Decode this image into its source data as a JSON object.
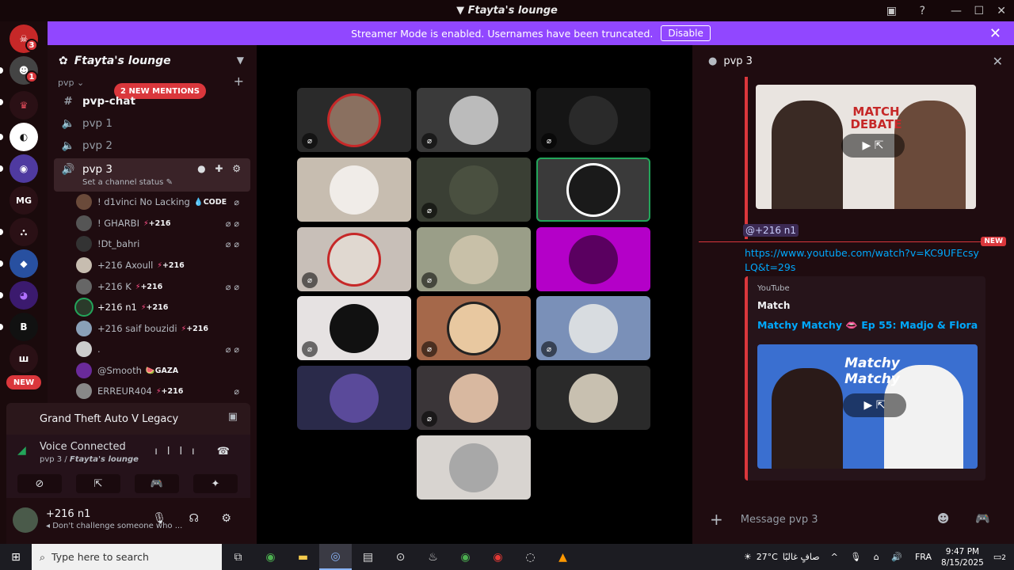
{
  "window": {
    "title": "Ftayta's lounge"
  },
  "servers": {
    "badges": [
      "3",
      "1"
    ],
    "new_label": "NEW",
    "mg_label": "MG"
  },
  "banner": {
    "text": "Streamer Mode is enabled. Usernames have been truncated.",
    "button": "Disable"
  },
  "sidebar": {
    "guild_name": "Ftayta's lounge",
    "category": "pvp",
    "mentions": "2 NEW MENTIONS",
    "channels": [
      {
        "label": "pvp-chat",
        "type": "text"
      },
      {
        "label": "pvp 1",
        "type": "voice"
      },
      {
        "label": "pvp 2",
        "type": "voice"
      },
      {
        "label": "pvp 3",
        "type": "voice",
        "status": "Set a channel status"
      }
    ],
    "voice_users": [
      {
        "name": "! d1vinci No Lacking",
        "tag": "CODE"
      },
      {
        "name": "! GHARBI",
        "tag": "+216"
      },
      {
        "name": "!Dt_bahri",
        "tag": ""
      },
      {
        "name": "+216 Axoull",
        "tag": "+216"
      },
      {
        "name": "+216 K",
        "tag": "+216"
      },
      {
        "name": "+216 n1",
        "tag": "+216"
      },
      {
        "name": "+216 saif bouzidi",
        "tag": "+216"
      },
      {
        "name": ".",
        "tag": ""
      },
      {
        "name": "@Smooth",
        "tag": "GAZA"
      },
      {
        "name": "ERREUR404",
        "tag": "+216"
      }
    ]
  },
  "activity": {
    "game": "Grand Theft Auto V Legacy"
  },
  "voice": {
    "status": "Voice Connected",
    "channel": "pvp 3",
    "server": "Ftayta's lounge"
  },
  "me": {
    "name": "+216 n1",
    "status": "Don't challenge someone who ..."
  },
  "chat": {
    "channel": "pvp 3",
    "mention": "@+216 n1",
    "new_tag": "NEW",
    "link": "https://www.youtube.com/watch?v=KC9UFEcsyLQ&t=29s",
    "embed_provider": "YouTube",
    "embed_author": "Match",
    "embed_title": "Matchy Matchy 👄 Ep 55: Madjo & Flora",
    "thumb1_text": "MATCH DEBATE",
    "thumb2_text": "Matchy Matchy",
    "placeholder": "Message pvp 3"
  },
  "taskbar": {
    "search": "Type here to search",
    "weather": "27°C",
    "weather_text": "صافٍ غالبًا",
    "lang": "FRA",
    "time": "9:47 PM",
    "date": "8/15/2025",
    "notifications": "2"
  },
  "colors": {
    "accent": "#9147ff",
    "danger": "#da373c",
    "speaking": "#23a55a",
    "link": "#00a8fc"
  }
}
